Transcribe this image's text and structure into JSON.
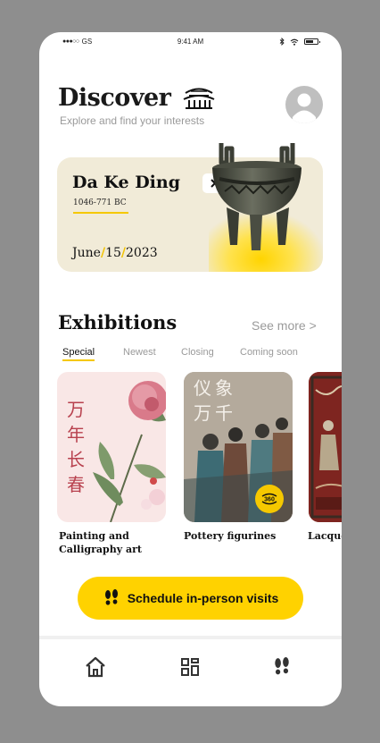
{
  "status": {
    "carrier": "GS",
    "time": "9:41 AM"
  },
  "header": {
    "title": "Discover",
    "subtitle": "Explore and find your interests"
  },
  "featured": {
    "name": "Da Ke Ding",
    "era": "1046-771 BC",
    "date_parts": [
      "June",
      "15",
      "2023"
    ]
  },
  "exhibitions": {
    "title": "Exhibitions",
    "see_more": "See more >",
    "tabs": [
      {
        "label": "Special",
        "active": true
      },
      {
        "label": "Newest",
        "active": false
      },
      {
        "label": "Closing",
        "active": false
      },
      {
        "label": "Coming soon",
        "active": false
      }
    ],
    "cards": [
      {
        "label_line1": "Painting and",
        "label_line2": "Calligraphy art",
        "cjk_chars": [
          "万",
          "年",
          "长",
          "春"
        ]
      },
      {
        "label": "Pottery figurines",
        "cjk_chars": [
          "仪",
          "象",
          "万",
          "千"
        ],
        "badge": "360"
      },
      {
        "label": "Lacque"
      }
    ]
  },
  "cta": {
    "label": "Schedule in-person visits"
  },
  "nav": {
    "items": [
      "home-icon",
      "grid-icon",
      "footprints-icon"
    ]
  },
  "colors": {
    "accent": "#ffd200",
    "card_bg": "#f1ebd8",
    "cjk_red": "#b8414e"
  }
}
